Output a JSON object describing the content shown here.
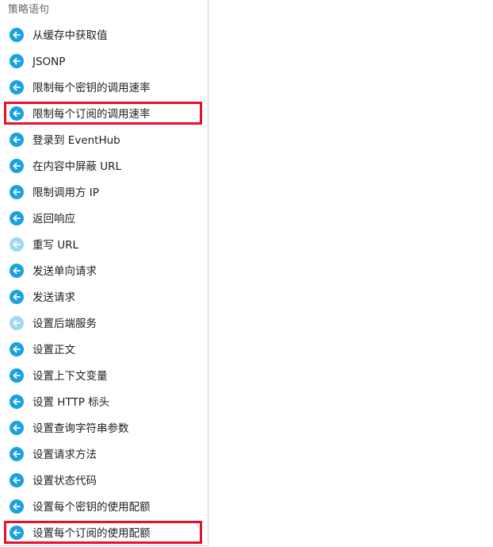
{
  "panel": {
    "title": "策略语句"
  },
  "items": [
    {
      "label": "从缓存中获取值",
      "icon": "arrow-left-circle-icon",
      "disabled": false,
      "highlighted": false
    },
    {
      "label": "JSONP",
      "icon": "arrow-left-circle-icon",
      "disabled": false,
      "highlighted": false
    },
    {
      "label": "限制每个密钥的调用速率",
      "icon": "arrow-left-circle-icon",
      "disabled": false,
      "highlighted": false
    },
    {
      "label": "限制每个订阅的调用速率",
      "icon": "arrow-left-circle-icon",
      "disabled": false,
      "highlighted": true
    },
    {
      "label": "登录到 EventHub",
      "icon": "arrow-left-circle-icon",
      "disabled": false,
      "highlighted": false
    },
    {
      "label": "在内容中屏蔽 URL",
      "icon": "arrow-left-circle-icon",
      "disabled": false,
      "highlighted": false
    },
    {
      "label": "限制调用方 IP",
      "icon": "arrow-left-circle-icon",
      "disabled": false,
      "highlighted": false
    },
    {
      "label": "返回响应",
      "icon": "arrow-left-circle-icon",
      "disabled": false,
      "highlighted": false
    },
    {
      "label": "重写 URL",
      "icon": "arrow-left-circle-icon",
      "disabled": true,
      "highlighted": false
    },
    {
      "label": "发送单向请求",
      "icon": "arrow-left-circle-icon",
      "disabled": false,
      "highlighted": false
    },
    {
      "label": "发送请求",
      "icon": "arrow-left-circle-icon",
      "disabled": false,
      "highlighted": false
    },
    {
      "label": "设置后端服务",
      "icon": "arrow-left-circle-icon",
      "disabled": true,
      "highlighted": false
    },
    {
      "label": "设置正文",
      "icon": "arrow-left-circle-icon",
      "disabled": false,
      "highlighted": false
    },
    {
      "label": "设置上下文变量",
      "icon": "arrow-left-circle-icon",
      "disabled": false,
      "highlighted": false
    },
    {
      "label": "设置 HTTP 标头",
      "icon": "arrow-left-circle-icon",
      "disabled": false,
      "highlighted": false
    },
    {
      "label": "设置查询字符串参数",
      "icon": "arrow-left-circle-icon",
      "disabled": false,
      "highlighted": false
    },
    {
      "label": "设置请求方法",
      "icon": "arrow-left-circle-icon",
      "disabled": false,
      "highlighted": false
    },
    {
      "label": "设置状态代码",
      "icon": "arrow-left-circle-icon",
      "disabled": false,
      "highlighted": false
    },
    {
      "label": "设置每个密钥的使用配额",
      "icon": "arrow-left-circle-icon",
      "disabled": false,
      "highlighted": false
    },
    {
      "label": "设置每个订阅的使用配额",
      "icon": "arrow-left-circle-icon",
      "disabled": false,
      "highlighted": true
    }
  ],
  "colors": {
    "icon_active": "#1aa1e2",
    "icon_disabled": "#9fd8f3",
    "highlight_border": "#e8112d"
  }
}
